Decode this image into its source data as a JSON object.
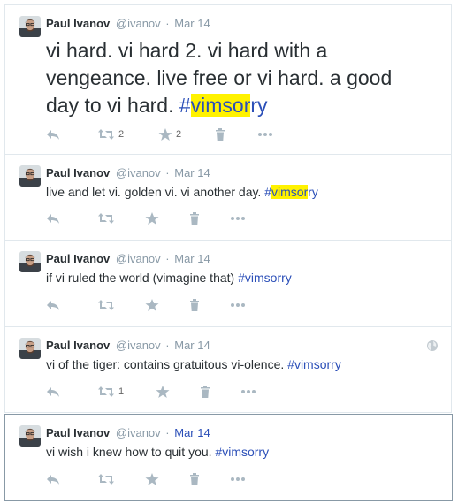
{
  "tweets": [
    {
      "fullname": "Paul Ivanov",
      "username": "@ivanov",
      "separator": "·",
      "time": "Mar 14",
      "text": "vi hard. vi hard 2. vi hard with a vengeance. live free or vi hard. a good day to vi hard. ",
      "hashtag_hash": "#",
      "hashtag_hl": "vimsor",
      "hashtag_tail": "ry",
      "retweet_count": "2",
      "favorite_count": "2"
    },
    {
      "fullname": "Paul Ivanov",
      "username": "@ivanov",
      "separator": "·",
      "time": "Mar 14",
      "text": "live and let vi. golden vi. vi another day. ",
      "hashtag_hash": "#",
      "hashtag_hl": "vimsor",
      "hashtag_tail": "ry"
    },
    {
      "fullname": "Paul Ivanov",
      "username": "@ivanov",
      "separator": "·",
      "time": "Mar 14",
      "text": "if vi ruled the world (vimagine that) ",
      "hashtag": "#vimsorry"
    },
    {
      "fullname": "Paul Ivanov",
      "username": "@ivanov",
      "separator": "·",
      "time": "Mar 14",
      "text": "vi of the tiger: contains gratuitous vi-olence. ",
      "hashtag": "#vimsorry",
      "retweet_count": "1"
    },
    {
      "fullname": "Paul Ivanov",
      "username": "@ivanov",
      "separator": "·",
      "time": "Mar 14",
      "text": "vi wish i knew how to quit you. ",
      "hashtag": "#vimsorry"
    }
  ],
  "colors": {
    "hashtag": "#2b4fb8",
    "highlight": "#fff200",
    "icon": "#aab8c2",
    "name": "#292f33",
    "meta": "#8899a6"
  },
  "icons": [
    "reply-icon",
    "retweet-icon",
    "favorite-icon",
    "delete-icon",
    "more-icon",
    "globe-icon"
  ]
}
